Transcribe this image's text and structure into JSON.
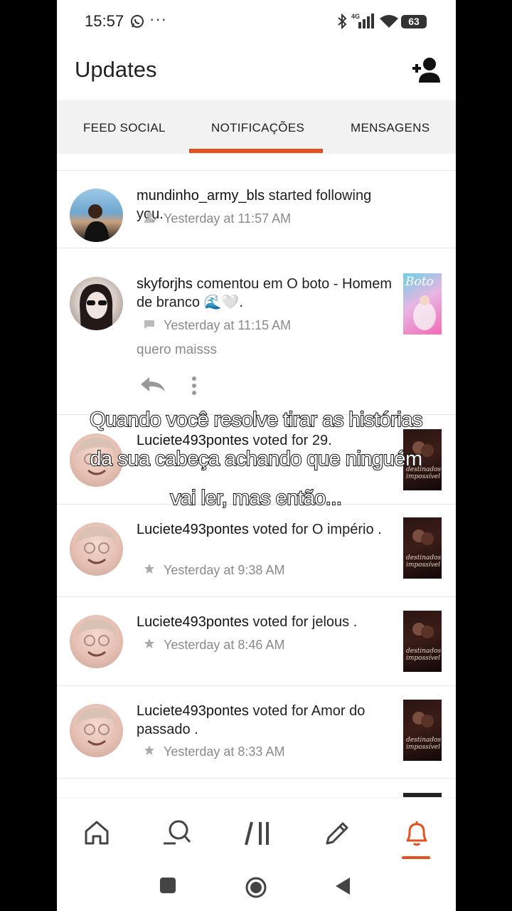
{
  "status_bar": {
    "time": "15:57",
    "more": "···",
    "network": "4G",
    "battery": "63"
  },
  "header": {
    "title": "Updates"
  },
  "tabs": [
    {
      "label": "FEED SOCIAL"
    },
    {
      "label": "NOTIFICAÇÕES",
      "active": true
    },
    {
      "label": "MENSAGENS"
    }
  ],
  "notifications": [
    {
      "user": "mundinho_army_bls",
      "action": "started following you.",
      "time": "Yesterday at 11:57 AM",
      "icon": "follow-icon"
    },
    {
      "user": "skyforjhs",
      "action": "comentou em",
      "story": "O boto - Homem de branco 🌊🤍",
      "end": ".",
      "time": "Yesterday at 11:15 AM",
      "comment": "quero maisss",
      "icon": "comment-icon",
      "cover_text": "Boto"
    },
    {
      "user": "Luciete493pontes",
      "action": "voted for",
      "story": "29",
      "end": ".",
      "time": "Yesterday at 10:01 AM",
      "icon": "star-icon"
    },
    {
      "user": "Luciete493pontes",
      "action": "voted for",
      "story": "O império",
      "end": " .",
      "time": "Yesterday at 9:38 AM",
      "icon": "star-icon"
    },
    {
      "user": "Luciete493pontes",
      "action": "voted for",
      "story": "jelous",
      "end": " .",
      "time": "Yesterday at 8:46 AM",
      "icon": "star-icon"
    },
    {
      "user": "Luciete493pontes",
      "action": "voted for",
      "story": "Amor do passado",
      "end": " .",
      "time": "Yesterday at 8:33 AM",
      "icon": "star-icon"
    }
  ],
  "cover_script": "destinados impossível",
  "caption": {
    "line1": "Quando você resolve tirar as histórias",
    "line2": "da sua cabeça achando que ninguém",
    "line3": "vai ler, mas então..."
  },
  "bottom_nav": [
    "home-icon",
    "search-icon",
    "library-icon",
    "write-icon",
    "notifications-icon"
  ],
  "colors": {
    "accent": "#e2511f",
    "text": "#222222",
    "meta": "#8a8a8a"
  }
}
